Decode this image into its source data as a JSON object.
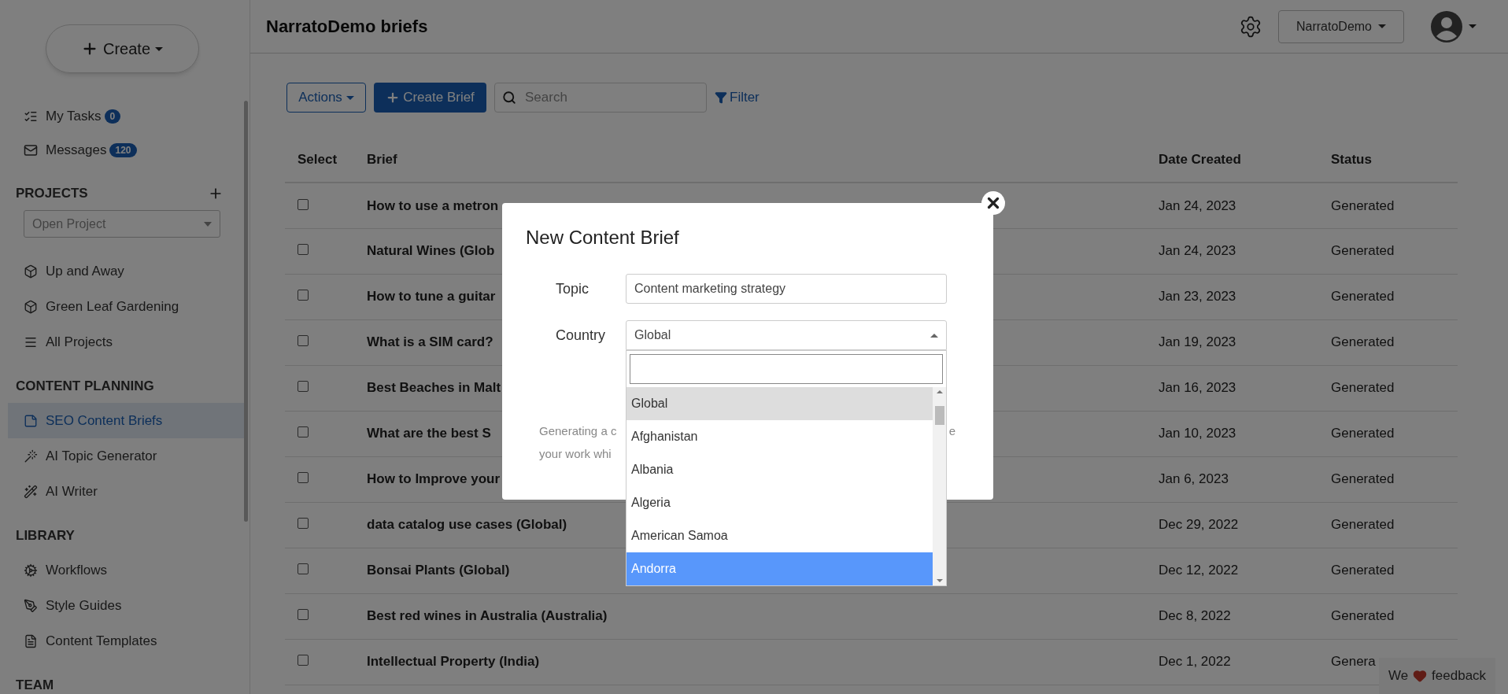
{
  "sidebar": {
    "create_label": "Create",
    "quick_links": [
      {
        "label": "My Tasks",
        "badge": "0",
        "selected": false
      },
      {
        "label": "Messages",
        "badge": "120",
        "selected": false
      }
    ],
    "sections": [
      {
        "heading": "PROJECTS",
        "select_placeholder": "Open Project",
        "items": [
          {
            "label": "Up and Away",
            "selected": false
          },
          {
            "label": "Green Leaf Gardening",
            "selected": false
          },
          {
            "label": "All Projects",
            "selected": false
          }
        ]
      },
      {
        "heading": "CONTENT PLANNING",
        "items": [
          {
            "label": "SEO Content Briefs",
            "selected": true
          },
          {
            "label": "AI Topic Generator",
            "selected": false
          },
          {
            "label": "AI Writer",
            "selected": false
          }
        ]
      },
      {
        "heading": "LIBRARY",
        "items": [
          {
            "label": "Workflows",
            "selected": false
          },
          {
            "label": "Style Guides",
            "selected": false
          },
          {
            "label": "Content Templates",
            "selected": false
          }
        ]
      },
      {
        "heading": "TEAM"
      }
    ]
  },
  "header": {
    "title": "NarratoDemo briefs",
    "account_menu": "NarratoDemo"
  },
  "toolbar": {
    "actions": "Actions",
    "create": "Create Brief",
    "search_placeholder": "Search",
    "filter": "Filter"
  },
  "table": {
    "columns": [
      "Select",
      "Brief",
      "Date Created",
      "Status"
    ],
    "rows": [
      {
        "checked": false,
        "brief": "How to use a metron",
        "date": "Jan 24, 2023",
        "status": "Generated"
      },
      {
        "checked": false,
        "brief": "Natural Wines (Glob",
        "date": "Jan 24, 2023",
        "status": "Generated"
      },
      {
        "checked": false,
        "brief": "How to tune a guitar",
        "date": "Jan 23, 2023",
        "status": "Generated"
      },
      {
        "checked": false,
        "brief": "What is a SIM card?",
        "date": "Jan 19, 2023",
        "status": "Generated"
      },
      {
        "checked": false,
        "brief": "Best Beaches in Malt",
        "date": "Jan 16, 2023",
        "status": "Generated"
      },
      {
        "checked": false,
        "brief": "What are the best S",
        "date": "Jan 10, 2023",
        "status": "Generated"
      },
      {
        "checked": false,
        "brief": "How to Improve your",
        "date": "Jan 6, 2023",
        "status": "Generated"
      },
      {
        "checked": false,
        "brief": "data catalog use cases (Global)",
        "date": "Dec 29, 2022",
        "status": "Generated"
      },
      {
        "checked": false,
        "brief": "Bonsai Plants (Global)",
        "date": "Dec 12, 2022",
        "status": "Generated"
      },
      {
        "checked": false,
        "brief": "Best red wines in Australia (Australia)",
        "date": "Dec 8, 2022",
        "status": "Generated"
      },
      {
        "checked": false,
        "brief": "Intellectual Property (India)",
        "date": "Dec 1, 2022",
        "status": "Genera"
      }
    ]
  },
  "modal": {
    "title": "New Content Brief",
    "topic": {
      "label": "Topic",
      "value": "Content marketing strategy"
    },
    "country": {
      "label": "Country",
      "value": "Global",
      "expanded": true
    },
    "options": [
      {
        "label": "Global",
        "selected": true,
        "highlighted": false
      },
      {
        "label": "Afghanistan",
        "selected": false,
        "highlighted": false
      },
      {
        "label": "Albania",
        "selected": false,
        "highlighted": false
      },
      {
        "label": "Algeria",
        "selected": false,
        "highlighted": false
      },
      {
        "label": "American Samoa",
        "selected": false,
        "highlighted": false
      },
      {
        "label": "Andorra",
        "selected": false,
        "highlighted": true
      }
    ],
    "helper_line1_start": "Generating a c",
    "helper_line1_end": "e",
    "helper_line2_start": "your work whi"
  },
  "feedback": {
    "before": "We",
    "after": "feedback"
  }
}
